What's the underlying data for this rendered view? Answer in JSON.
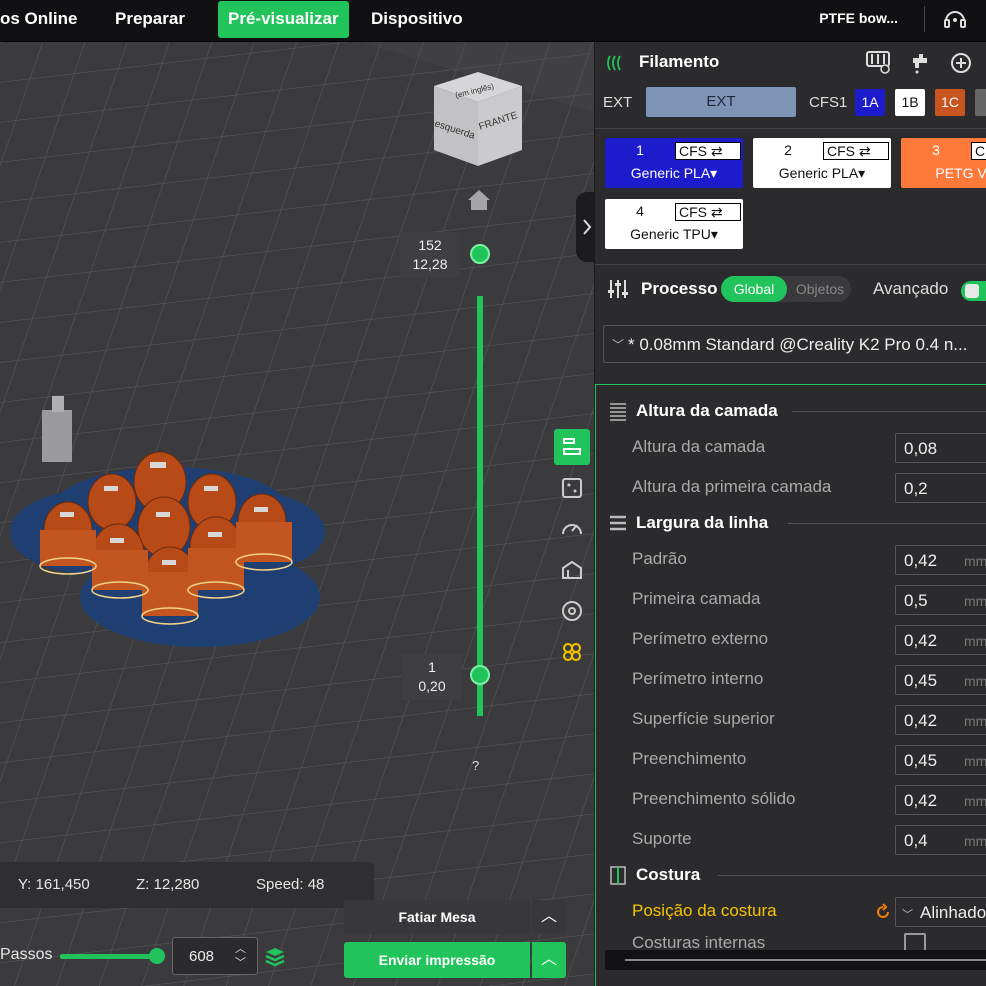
{
  "topbar": {
    "tabs": [
      {
        "label": "os Online",
        "active": false
      },
      {
        "label": "Preparar",
        "active": false
      },
      {
        "label": "Pré-visualizar",
        "active": true
      },
      {
        "label": "Dispositivo",
        "active": false
      }
    ],
    "printer_name": "PTFE bow...",
    "accent": "#20c45a"
  },
  "viewport": {
    "view_cube": {
      "top_text": "(em inglês)",
      "left_text": "esquerda",
      "front_text": "FRANTE"
    },
    "layer_slider": {
      "top": {
        "layer": "152",
        "height": "12,28"
      },
      "bottom": {
        "layer": "1",
        "height": "0,20"
      },
      "help": "?"
    },
    "side_tools": [
      "layer-view-icon",
      "layout-icon",
      "speed-gauge-icon",
      "support-icon",
      "target-icon",
      "cura-icon"
    ],
    "status": {
      "y": "Y: 161,450",
      "z": "Z: 12,280",
      "speed": "Speed: 48"
    },
    "steps": {
      "label": "Passos",
      "value": "608"
    },
    "buttons": {
      "slice": "Fatiar Mesa",
      "send": "Enviar impressão"
    }
  },
  "panel": {
    "filament_title": "Filamento",
    "ext_label": "EXT",
    "ext_button": "EXT",
    "cfs_label": "CFS1",
    "slots": [
      {
        "label": "1A",
        "bg": "#1c1ccc",
        "fg": "#ffffff"
      },
      {
        "label": "1B",
        "bg": "#ffffff",
        "fg": "#111111"
      },
      {
        "label": "1C",
        "bg": "#c8541f",
        "fg": "#ffffff"
      }
    ],
    "filaments": [
      {
        "num": "1",
        "cfs": "CFS ⇄",
        "name": "Generic PLA▾",
        "bg": "#1c1ccc",
        "fg": "#ffffff"
      },
      {
        "num": "2",
        "cfs": "CFS ⇄",
        "name": "Generic PLA▾",
        "bg": "#ffffff",
        "fg": "#111111"
      },
      {
        "num": "3",
        "cfs": "CF",
        "name": "PETG Vool",
        "bg": "#ff7a3a",
        "fg": "#ffffff"
      },
      {
        "num": "4",
        "cfs": "CFS ⇄",
        "name": "Generic TPU▾",
        "bg": "#ffffff",
        "fg": "#111111"
      }
    ],
    "process_title": "Processo",
    "toggle_global": "Global",
    "toggle_objects": "Objetos",
    "advanced_label": "Avançado",
    "preset": "* 0.08mm Standard @Creality K2 Pro 0.4 n...",
    "sections": {
      "layer_height": "Altura da camada",
      "line_width": "Largura da linha",
      "seam": "Costura"
    },
    "layer_rows": [
      {
        "name": "Altura da camada",
        "value": "0,08",
        "unit": ""
      },
      {
        "name": "Altura da primeira camada",
        "value": "0,2",
        "unit": ""
      }
    ],
    "width_rows": [
      {
        "name": "Padrão",
        "value": "0,42",
        "unit": "mm"
      },
      {
        "name": "Primeira camada",
        "value": "0,5",
        "unit": "mm"
      },
      {
        "name": "Perímetro externo",
        "value": "0,42",
        "unit": "mm"
      },
      {
        "name": "Perímetro interno",
        "value": "0,45",
        "unit": "mm"
      },
      {
        "name": "Superfície superior",
        "value": "0,42",
        "unit": "mm"
      },
      {
        "name": "Preenchimento",
        "value": "0,45",
        "unit": "mm"
      },
      {
        "name": "Preenchimento sólido",
        "value": "0,42",
        "unit": "mm"
      },
      {
        "name": "Suporte",
        "value": "0,4",
        "unit": "mm"
      }
    ],
    "seam_position": {
      "name": "Posição da costura",
      "value": "Alinhado"
    },
    "internal_seams": {
      "name": "Costuras internas"
    }
  }
}
